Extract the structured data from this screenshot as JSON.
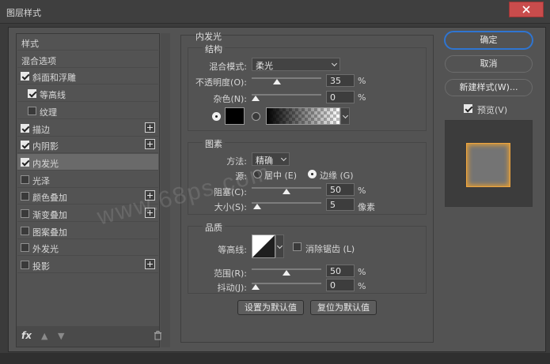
{
  "window": {
    "title": "图层样式"
  },
  "style_list": {
    "items": [
      {
        "label": "样式",
        "checkbox": false,
        "checked": false,
        "plus": false,
        "selected": false,
        "indent": false
      },
      {
        "label": "混合选项",
        "checkbox": false,
        "checked": false,
        "plus": false,
        "selected": false,
        "indent": false
      },
      {
        "label": "斜面和浮雕",
        "checkbox": true,
        "checked": true,
        "plus": false,
        "selected": false,
        "indent": false
      },
      {
        "label": "等高线",
        "checkbox": true,
        "checked": true,
        "plus": false,
        "selected": false,
        "indent": true
      },
      {
        "label": "纹理",
        "checkbox": true,
        "checked": false,
        "plus": false,
        "selected": false,
        "indent": true
      },
      {
        "label": "描边",
        "checkbox": true,
        "checked": true,
        "plus": true,
        "selected": false,
        "indent": false
      },
      {
        "label": "内阴影",
        "checkbox": true,
        "checked": true,
        "plus": true,
        "selected": false,
        "indent": false
      },
      {
        "label": "内发光",
        "checkbox": true,
        "checked": true,
        "plus": false,
        "selected": true,
        "indent": false
      },
      {
        "label": "光泽",
        "checkbox": true,
        "checked": false,
        "plus": false,
        "selected": false,
        "indent": false
      },
      {
        "label": "颜色叠加",
        "checkbox": true,
        "checked": false,
        "plus": true,
        "selected": false,
        "indent": false
      },
      {
        "label": "渐变叠加",
        "checkbox": true,
        "checked": false,
        "plus": true,
        "selected": false,
        "indent": false
      },
      {
        "label": "图案叠加",
        "checkbox": true,
        "checked": false,
        "plus": false,
        "selected": false,
        "indent": false
      },
      {
        "label": "外发光",
        "checkbox": true,
        "checked": false,
        "plus": false,
        "selected": false,
        "indent": false
      },
      {
        "label": "投影",
        "checkbox": true,
        "checked": false,
        "plus": true,
        "selected": false,
        "indent": false
      }
    ],
    "fx_label": "fx"
  },
  "panel": {
    "title": "内发光",
    "structure": {
      "title": "结构",
      "blend_mode_label": "混合模式:",
      "blend_mode_value": "柔光",
      "opacity_label": "不透明度(O):",
      "opacity_value": "35",
      "opacity_fraction": 0.35,
      "noise_label": "杂色(N):",
      "noise_value": "0",
      "noise_fraction": 0.0,
      "percent": "%"
    },
    "elements": {
      "title": "图素",
      "method_label": "方法:",
      "method_value": "精确",
      "source_label": "源:",
      "source_center": "居中 (E)",
      "source_edge": "边缘 (G)",
      "choke_label": "阻塞(C):",
      "choke_value": "50",
      "choke_fraction": 0.5,
      "size_label": "大小(S):",
      "size_value": "5",
      "size_fraction": 0.02,
      "size_unit": "像素",
      "percent": "%"
    },
    "quality": {
      "title": "品质",
      "contour_label": "等高线:",
      "anti_alias_label": "消除锯齿 (L)",
      "range_label": "范围(R):",
      "range_value": "50",
      "range_fraction": 0.5,
      "jitter_label": "抖动(J):",
      "jitter_value": "0",
      "jitter_fraction": 0.0,
      "percent": "%"
    },
    "set_default": "设置为默认值",
    "reset_default": "复位为默认值"
  },
  "right": {
    "ok": "确定",
    "cancel": "取消",
    "new_style": "新建样式(W)...",
    "preview_label": "预览(V)",
    "preview_checked": true
  },
  "watermark": "www.68ps.com",
  "colors": {
    "accent": "#2f75d1",
    "glow": "#f0a640",
    "close": "#c94c4c"
  }
}
